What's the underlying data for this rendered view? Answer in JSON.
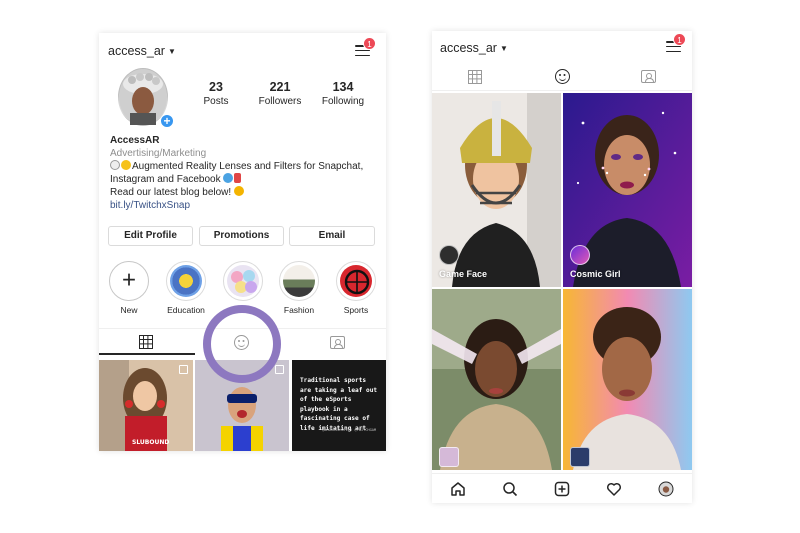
{
  "left_screen": {
    "username": "access_ar",
    "notification_count": "1",
    "stats": [
      {
        "num": "23",
        "label": "Posts"
      },
      {
        "num": "221",
        "label": "Followers"
      },
      {
        "num": "134",
        "label": "Following"
      }
    ],
    "bio": {
      "name": "AccessAR",
      "category": "Advertising/Marketing",
      "line1": "Augmented Reality Lenses and Filters for Snapchat,",
      "line2": "Instagram and Facebook",
      "line3": "Read our latest blog below!",
      "link": "bit.ly/TwitchxSnap"
    },
    "buttons": [
      "Edit Profile",
      "Promotions",
      "Email"
    ],
    "highlights": [
      {
        "label": "New",
        "icon": "plus-icon"
      },
      {
        "label": "Education",
        "icon": "education-highlight"
      },
      {
        "label": "",
        "icon": "hearts-highlight"
      },
      {
        "label": "Fashion",
        "icon": "fashion-highlight"
      },
      {
        "label": "Sports",
        "icon": "raptors-highlight"
      }
    ],
    "tabs": [
      "grid-icon",
      "face-filter-icon",
      "tagged-icon"
    ],
    "post3_text": "Traditional sports are taking a leaf out of the eSports playbook in a fascinating case of life imitating art",
    "post3_handle": "@AROXXSSHOTIFY  @TWITCHGAM"
  },
  "right_screen": {
    "username": "access_ar",
    "notification_count": "1",
    "effects": [
      {
        "label": "Game Face"
      },
      {
        "label": "Cosmic Girl"
      },
      {
        "label": ""
      },
      {
        "label": ""
      }
    ],
    "bottom_nav": [
      "home-icon",
      "search-icon",
      "add-icon",
      "heart-icon",
      "profile-icon"
    ]
  },
  "colors": {
    "accent_circle": "#8d78c0",
    "notification": "#ed4956",
    "link": "#385185",
    "plus_badge": "#3897f0"
  }
}
